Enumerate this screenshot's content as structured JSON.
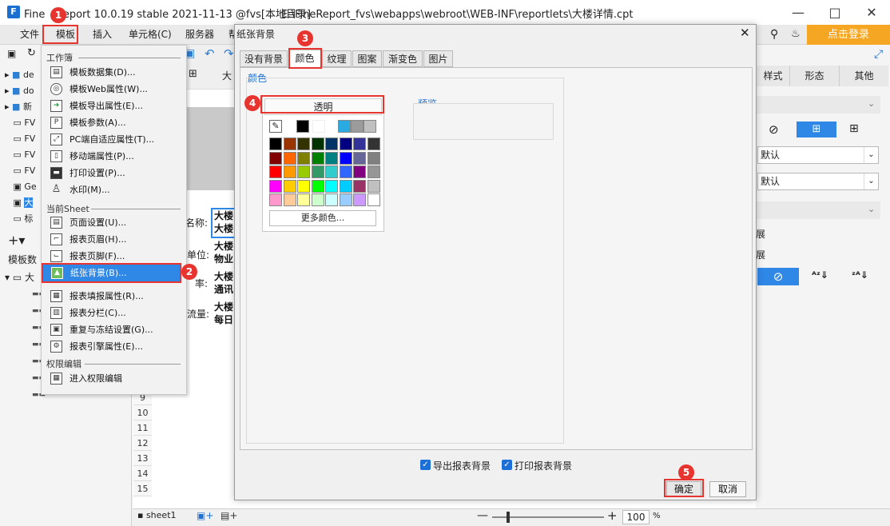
{
  "window": {
    "title": "FineReport 10.0.19 stable 2021-11-13 @fvs[本地目录]",
    "title_suffix": "Re",
    "path": "E:\\FineReport_fvs\\webapps\\webroot\\WEB-INF\\reportlets\\大楼详情.cpt",
    "login_label": "点击登录"
  },
  "menubar": {
    "items": [
      "文件",
      "模板",
      "插入",
      "单元格(C)",
      "服务器",
      "帮"
    ]
  },
  "tree": {
    "items": [
      "de",
      "do",
      "新",
      "FV",
      "FV",
      "FV",
      "FV",
      "Ge",
      "大",
      "标"
    ],
    "dataset_label": "模板数",
    "dataset_root": "大"
  },
  "context_menu": {
    "section1": "工作簿",
    "section1_items": [
      "模板数据集(D)...",
      "模板Web属性(W)...",
      "模板导出属性(E)...",
      "模板参数(A)...",
      "PC端自适应属性(T)...",
      "移动端属性(P)...",
      "打印设置(P)...",
      "水印(M)..."
    ],
    "section2": "当前Sheet",
    "section2_items": [
      "页面设置(U)...",
      "报表页眉(H)...",
      "报表页脚(F)...",
      "纸张背景(B)...",
      "报表填报属性(R)...",
      "报表分栏(C)...",
      "重复与冻结设置(G)...",
      "报表引擎属性(E)..."
    ],
    "section3": "权限编辑",
    "section3_items": [
      "进入权限编辑"
    ]
  },
  "sheet": {
    "labels": [
      "名称:",
      "单位:",
      "率:",
      "流量:"
    ],
    "values": [
      [
        "大楼",
        "大楼"
      ],
      [
        "大楼",
        "物业"
      ],
      [
        "大楼",
        "通讯"
      ],
      [
        "大楼",
        "每日"
      ]
    ],
    "row_numbers": [
      "9",
      "10",
      "11",
      "12",
      "13",
      "14",
      "15"
    ],
    "col_letter": "大",
    "sheet_tab": "sheet1",
    "zoom": "100",
    "zoom_unit": "%"
  },
  "right_panel": {
    "tabs": [
      "样式",
      "形态",
      "其他"
    ],
    "select1": "默认",
    "select2": "默认",
    "frag1": "展",
    "frag2": "展"
  },
  "dialog": {
    "title": "纸张背景",
    "tabs": [
      "没有背景",
      "颜色",
      "纹理",
      "图案",
      "渐变色",
      "图片"
    ],
    "group_label": "颜色",
    "transparent_label": "透明",
    "preview_label": "预览",
    "more_colors": "更多颜色...",
    "export_bg": "导出报表背景",
    "print_bg": "打印报表背景",
    "ok": "确定",
    "cancel": "取消"
  },
  "badges": [
    "1",
    "2",
    "3",
    "4",
    "5"
  ],
  "palette": {
    "recent": [
      "#000000",
      "#ffffff",
      "#29abe2",
      "#9b9b9b",
      "#c0c0c0"
    ],
    "grid": [
      [
        "#000000",
        "#993300",
        "#333300",
        "#003300",
        "#003366",
        "#000080",
        "#333399",
        "#333333"
      ],
      [
        "#800000",
        "#ff6600",
        "#808000",
        "#008000",
        "#008080",
        "#0000ff",
        "#666699",
        "#808080"
      ],
      [
        "#ff0000",
        "#ff9900",
        "#99cc00",
        "#339966",
        "#33cccc",
        "#3366ff",
        "#800080",
        "#969696"
      ],
      [
        "#ff00ff",
        "#ffcc00",
        "#ffff00",
        "#00ff00",
        "#00ffff",
        "#00ccff",
        "#993366",
        "#c0c0c0"
      ],
      [
        "#ff99cc",
        "#ffcc99",
        "#ffff99",
        "#ccffcc",
        "#ccffff",
        "#99ccff",
        "#cc99ff",
        "#ffffff"
      ]
    ]
  },
  "colors": {
    "accent": "#e8342e",
    "login_bg": "#f5a623",
    "blue_check": "#1d71d6",
    "active_icon_bg": "#2f87e6"
  }
}
